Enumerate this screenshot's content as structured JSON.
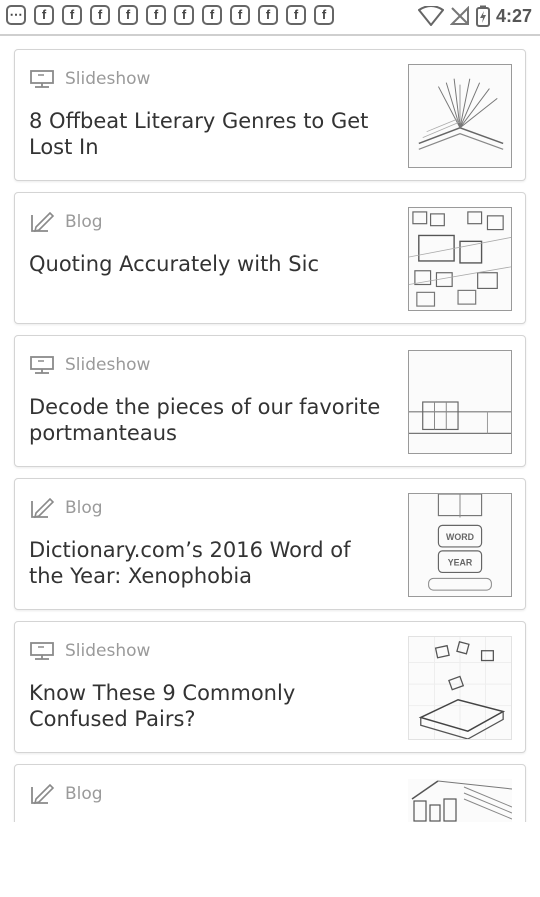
{
  "status_bar": {
    "time": "4:27",
    "notification_glyph": "f",
    "icons": [
      "more-icon",
      "facebook-icon",
      "facebook-icon",
      "facebook-icon",
      "facebook-icon",
      "facebook-icon",
      "facebook-icon",
      "facebook-icon",
      "facebook-icon",
      "facebook-icon",
      "facebook-icon",
      "facebook-icon"
    ]
  },
  "feed": {
    "items": [
      {
        "type": "Slideshow",
        "icon": "slideshow-icon",
        "title": "8 Offbeat Literary Genres to Get Lost In",
        "thumbnail": "open-book"
      },
      {
        "type": "Blog",
        "icon": "blog-icon",
        "title": "Quoting Accurately with Sic",
        "thumbnail": "typewriter-keys"
      },
      {
        "type": "Slideshow",
        "icon": "slideshow-icon",
        "title": "Decode the pieces of our favorite portmanteaus",
        "thumbnail": "room-shelf"
      },
      {
        "type": "Blog",
        "icon": "blog-icon",
        "title": "Dictionary.com’s 2016 Word of the Year: Xenophobia",
        "thumbnail": "word-of-the-year-banner",
        "thumbnail_text": [
          "WORD",
          "YEAR"
        ]
      },
      {
        "type": "Slideshow",
        "icon": "slideshow-icon",
        "title": "Know These 9 Commonly Confused Pairs?",
        "thumbnail": "scattered-letters-box"
      },
      {
        "type": "Blog",
        "icon": "blog-icon",
        "title": "",
        "thumbnail": "city-sketch"
      }
    ]
  }
}
